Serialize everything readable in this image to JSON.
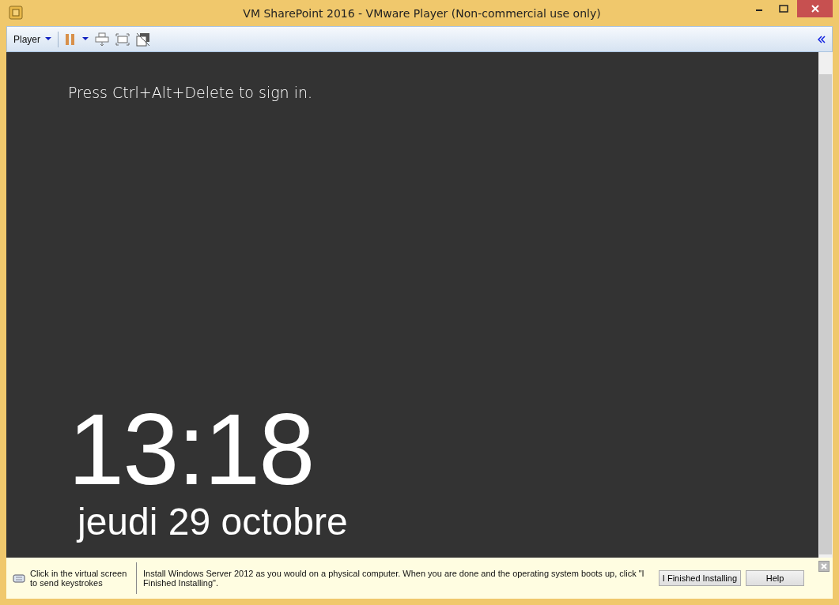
{
  "window": {
    "title": "VM SharePoint 2016 - VMware Player (Non-commercial use only)"
  },
  "toolbar": {
    "menu": "Player"
  },
  "vm_screen": {
    "prompt": "Press Ctrl+Alt+Delete to sign in.",
    "time": "13:18",
    "date": "jeudi 29 octobre"
  },
  "hint_bar": {
    "keyboard_hint": "Click in the virtual screen to send keystrokes",
    "message": "Install Windows Server 2012 as you would on a physical computer. When you are done and the operating system boots up, click \"I Finished Installing\".",
    "buttons": [
      "I Finished Installing",
      "Help"
    ]
  }
}
